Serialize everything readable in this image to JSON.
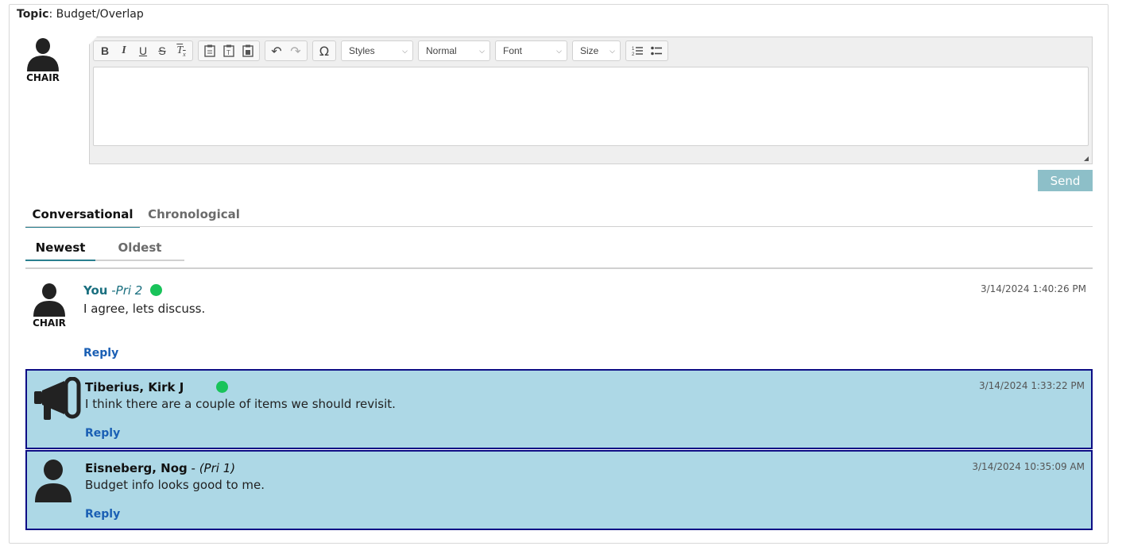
{
  "topic": {
    "label": "Topic",
    "value": "Budget/Overlap"
  },
  "composer": {
    "avatar_label": "CHAIR",
    "toolbar": {
      "styles": "Styles",
      "format": "Normal",
      "font": "Font",
      "size": "Size"
    },
    "send_label": "Send"
  },
  "view_tabs": [
    {
      "label": "Conversational",
      "active": true
    },
    {
      "label": "Chronological",
      "active": false
    }
  ],
  "sort_tabs": [
    {
      "label": "Newest",
      "active": true
    },
    {
      "label": "Oldest",
      "active": false
    }
  ],
  "messages": [
    {
      "author": "You",
      "priority": " -Pri 2",
      "avatar_label": "CHAIR",
      "avatar_icon": "user-icon",
      "online": true,
      "timestamp": "3/14/2024 1:40:26 PM",
      "text": "I agree, lets discuss.",
      "reply_label": "Reply"
    },
    {
      "author": "Tiberius, Kirk J",
      "priority": "",
      "avatar_icon": "megaphone-icon",
      "online": true,
      "timestamp": "3/14/2024 1:33:22 PM",
      "text": "I think there are a couple of items we should revisit.",
      "reply_label": "Reply"
    },
    {
      "author": "Eisneberg, Nog",
      "priority_sep": " - ",
      "priority": "(Pri 1)",
      "avatar_icon": "user-icon",
      "online": false,
      "timestamp": "3/14/2024 10:35:09 AM",
      "text": "Budget info looks good to me.",
      "reply_label": "Reply"
    }
  ],
  "colors": {
    "highlight_bg": "#add8e6",
    "highlight_border": "#0d0d85",
    "online_dot": "#19c35a",
    "send_button": "#8dbfc8",
    "link": "#1a5fb4"
  }
}
